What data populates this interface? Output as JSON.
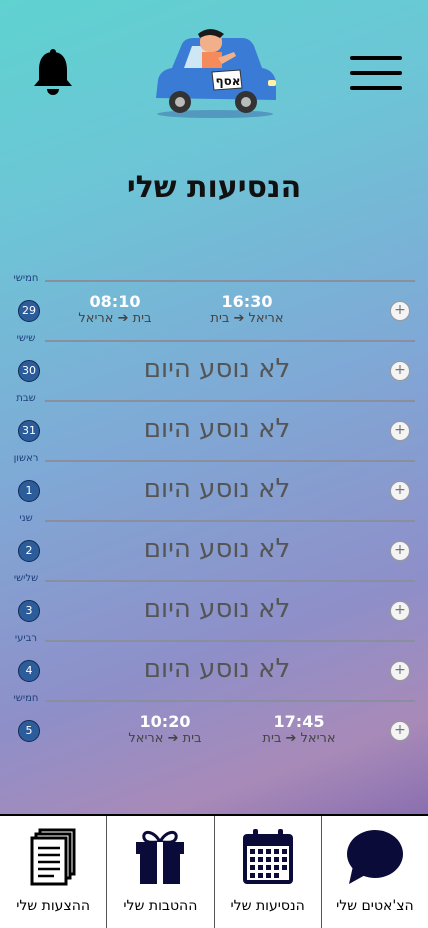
{
  "header": {
    "title": "הנסיעות שלי",
    "logo_text": "אסף"
  },
  "days": [
    {
      "name": "חמישי",
      "date": "29",
      "rides": [
        {
          "time": "08:10",
          "route": "בית ➔ אריאל"
        },
        {
          "time": "16:30",
          "route": "אריאל ➔ בית"
        }
      ]
    },
    {
      "name": "שישי",
      "date": "30",
      "status": "לא נוסע היום"
    },
    {
      "name": "שבת",
      "date": "31",
      "status": "לא נוסע היום"
    },
    {
      "name": "ראשון",
      "date": "1",
      "status": "לא נוסע היום"
    },
    {
      "name": "שני",
      "date": "2",
      "status": "לא נוסע היום"
    },
    {
      "name": "שלישי",
      "date": "3",
      "status": "לא נוסע היום"
    },
    {
      "name": "רביעי",
      "date": "4",
      "status": "לא נוסע היום"
    },
    {
      "name": "חמישי",
      "date": "5",
      "rides": [
        {
          "time": "10:20",
          "route": "בית ➔ אריאל"
        },
        {
          "time": "17:45",
          "route": "אריאל ➔ בית"
        }
      ]
    }
  ],
  "add_symbol": "+",
  "nav": [
    {
      "label": "ההצעות שלי",
      "icon": "documents-icon"
    },
    {
      "label": "ההטבות שלי",
      "icon": "gift-icon"
    },
    {
      "label": "הנסיעות שלי",
      "icon": "calendar-icon"
    },
    {
      "label": "הצ'אטים שלי",
      "icon": "chat-bubble-icon"
    }
  ]
}
